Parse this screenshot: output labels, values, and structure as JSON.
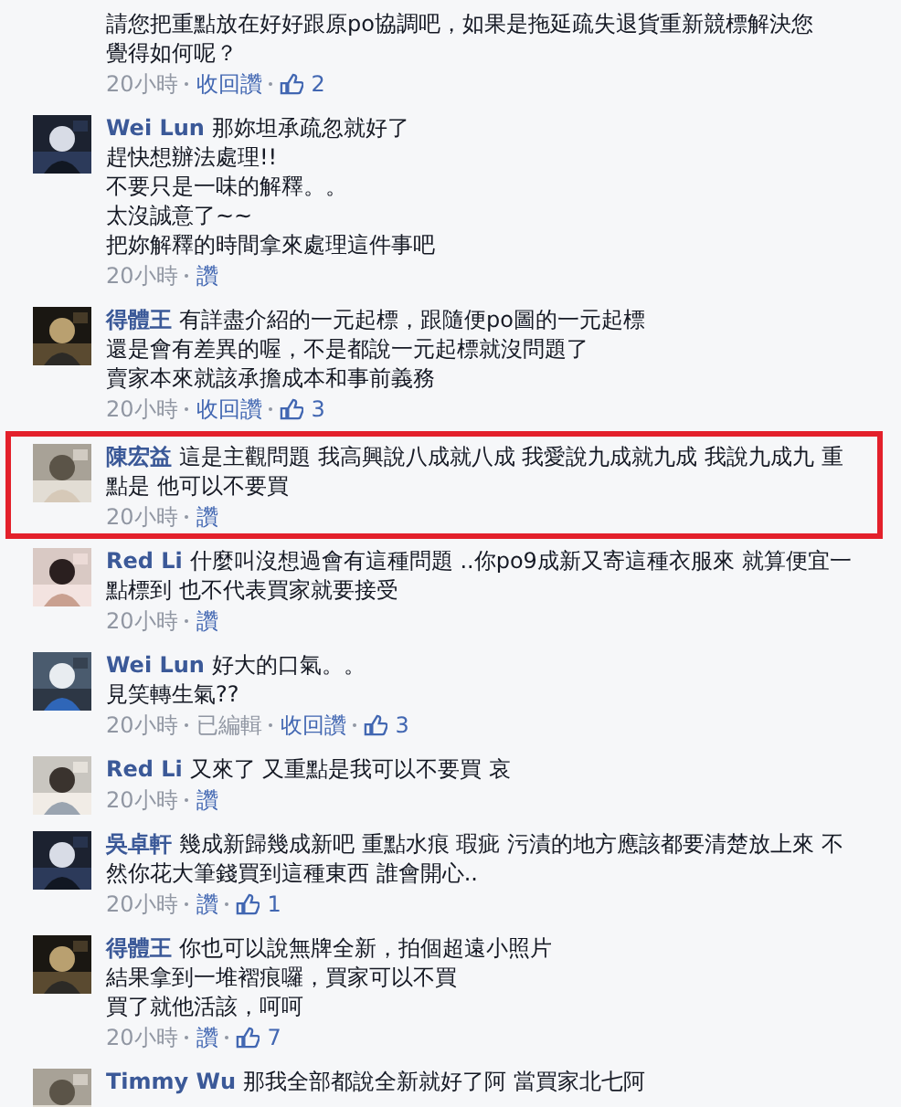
{
  "comments": [
    {
      "lines": [
        "請您把重點放在好好跟原po協調吧，如果是拖延疏失退貨重新競標解決您",
        "覺得如何呢？"
      ],
      "time": "20小時",
      "action": "收回讚",
      "likes": "2",
      "highlighted": false
    },
    {
      "author": "Wei Lun",
      "lines": [
        "那妳坦承疏忽就好了",
        "趕快想辦法處理!!",
        "不要只是一味的解釋。。",
        "太沒誠意了~~",
        "把妳解釋的時間拿來處理這件事吧"
      ],
      "time": "20小時",
      "action": "讚",
      "highlighted": false,
      "avatar": {
        "kind": "picture"
      }
    },
    {
      "author": "得體王",
      "lines": [
        "有詳盡介紹的一元起標，跟隨便po圖的一元起標",
        "還是會有差異的喔，不是都說一元起標就沒問題了",
        "賣家本來就該承擔成本和事前義務"
      ],
      "time": "20小時",
      "action": "收回讚",
      "likes": "3",
      "highlighted": false,
      "avatar": {
        "kind": "picture"
      }
    },
    {
      "author": "陳宏益",
      "lines": [
        "這是主觀問題 我高興說八成就八成 我愛說九成就九成 我說九成九 重點是 他可以不要買"
      ],
      "time": "20小時",
      "action": "讚",
      "highlighted": true,
      "avatar": {
        "kind": "picture"
      }
    },
    {
      "author": "Red Li",
      "lines": [
        "什麼叫沒想過會有這種問題 ..你po9成新又寄這種衣服來 就算便宜一點標到 也不代表買家就要接受"
      ],
      "time": "20小時",
      "action": "讚",
      "highlighted": false,
      "avatar": {
        "kind": "picture"
      }
    },
    {
      "author": "Wei Lun",
      "lines": [
        "好大的口氣。。",
        "見笑轉生氣??"
      ],
      "time": "20小時",
      "edited": "已編輯",
      "action": "收回讚",
      "likes": "3",
      "highlighted": false,
      "avatar": {
        "kind": "picture"
      }
    },
    {
      "author": "Red Li",
      "lines": [
        "又來了 又重點是我可以不要買 哀"
      ],
      "time": "20小時",
      "action": "讚",
      "highlighted": false,
      "avatar": {
        "kind": "picture"
      }
    },
    {
      "author": "吳卓軒",
      "lines": [
        "幾成新歸幾成新吧 重點水痕 瑕疵 污漬的地方應該都要清楚放上來 不然你花大筆錢買到這種東西 誰會開心.."
      ],
      "time": "20小時",
      "action": "讚",
      "likes": "1",
      "highlighted": false,
      "avatar": {
        "kind": "picture"
      }
    },
    {
      "author": "得體王",
      "lines": [
        "你也可以說無牌全新，拍個超遠小照片",
        "結果拿到一堆褶痕囉，買家可以不買",
        "買了就他活該，呵呵"
      ],
      "time": "20小時",
      "action": "讚",
      "likes": "7",
      "highlighted": false,
      "avatar": {
        "kind": "picture"
      }
    },
    {
      "author": "Timmy Wu",
      "lines": [
        "那我全部都說全新就好了阿 當買家北七阿"
      ],
      "highlighted": false,
      "avatar": {
        "kind": "picture"
      }
    }
  ]
}
